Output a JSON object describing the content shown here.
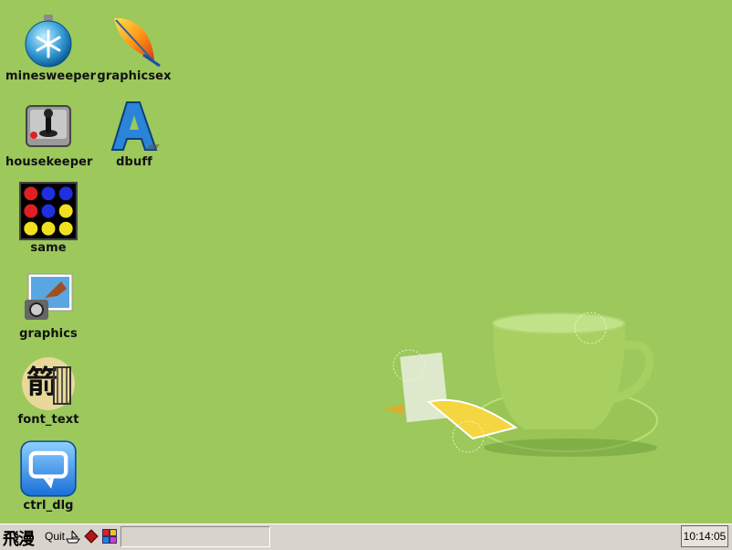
{
  "desktop": {
    "background_color": "#9cc85c",
    "icons": [
      {
        "id": "minesweeper",
        "label": "minesweeper",
        "icon": "snowflake-bomb-icon"
      },
      {
        "id": "graphicsex",
        "label": "graphicsex",
        "icon": "feather-icon"
      },
      {
        "id": "housekeeper",
        "label": "housekeeper",
        "icon": "joystick-icon"
      },
      {
        "id": "dbuff",
        "label": "dbuff",
        "icon": "letter-a-icon"
      },
      {
        "id": "same",
        "label": "same",
        "icon": "colored-balls-icon"
      },
      {
        "id": "graphics",
        "label": "graphics",
        "icon": "camera-photo-icon"
      },
      {
        "id": "font_text",
        "label": "font_text",
        "icon": "chinese-calligraphy-icon"
      },
      {
        "id": "ctrl_dlg",
        "label": "ctrl_dlg",
        "icon": "chat-bubble-icon"
      }
    ]
  },
  "taskbar": {
    "start_label": "飛漫",
    "quit_label": "Quit",
    "quicklaunch": [
      "ship-icon",
      "red-diamond-icon",
      "grid-icon"
    ],
    "clock": "10:14:05"
  }
}
